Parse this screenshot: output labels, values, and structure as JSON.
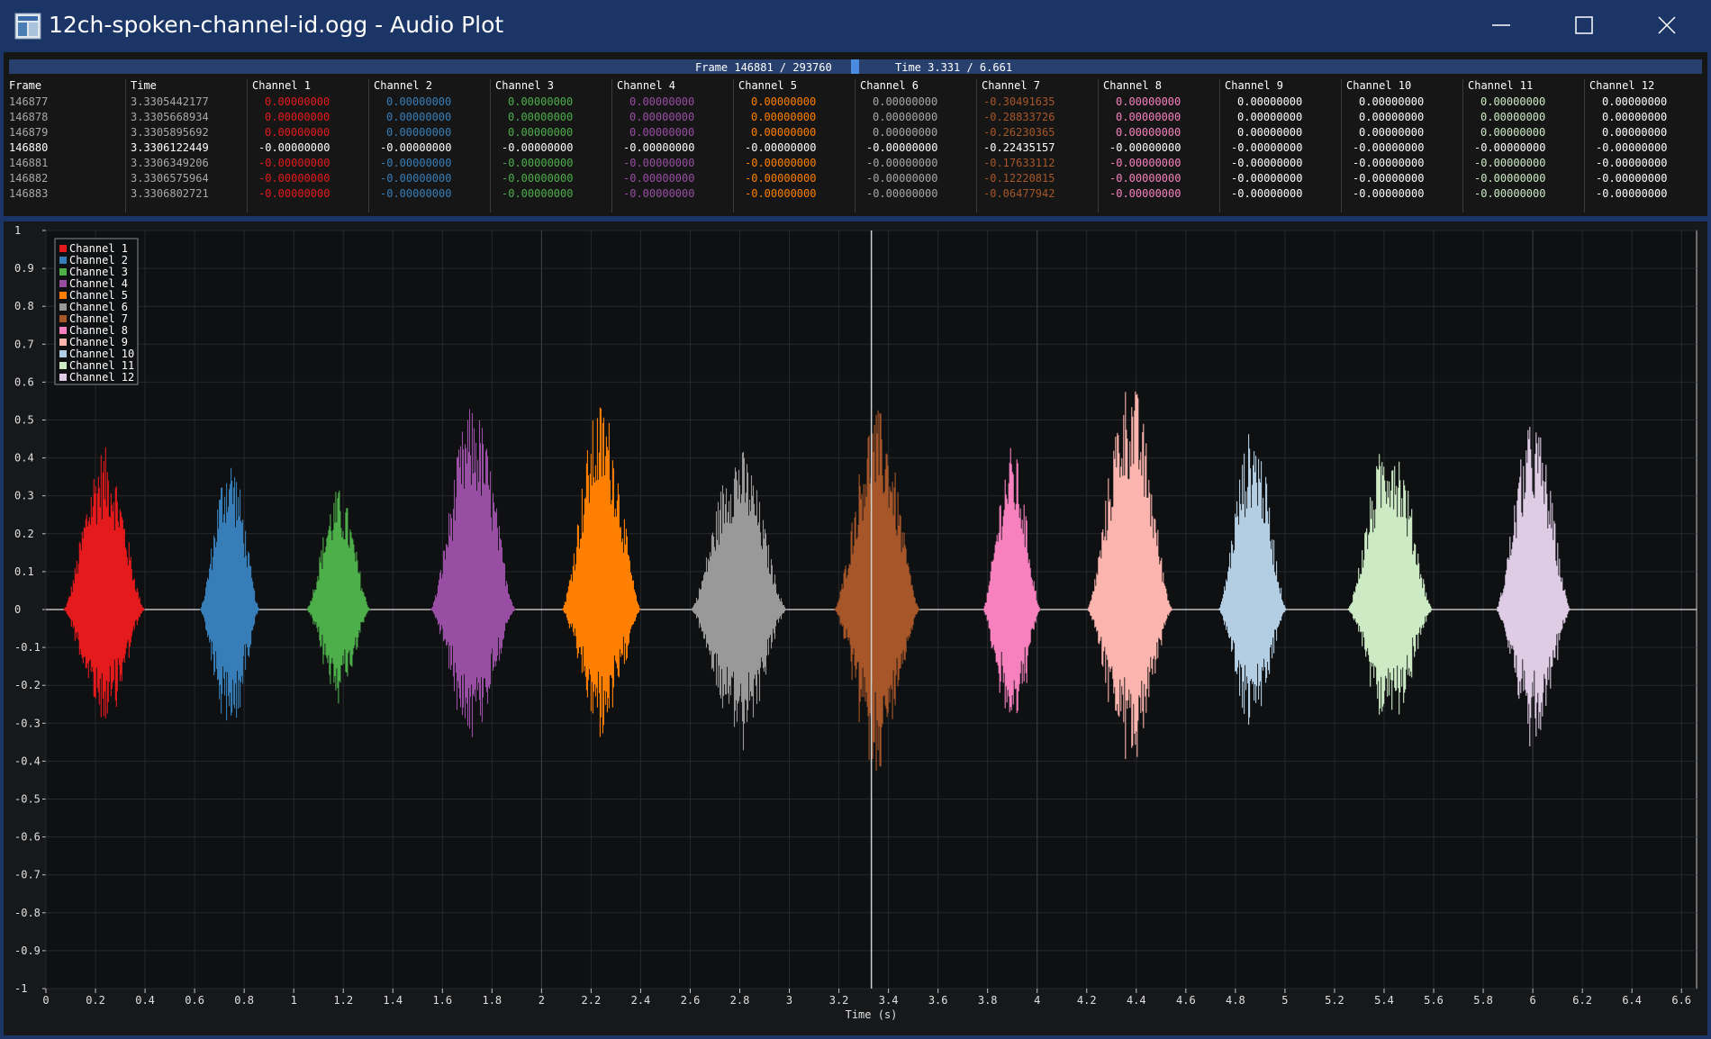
{
  "window": {
    "title": "12ch-spoken-channel-id.ogg - Audio Plot",
    "icon": "app-icon",
    "controls": [
      "minimize-icon",
      "maximize-icon",
      "close-icon"
    ]
  },
  "status": {
    "frame_text": "Frame 146881 / 293760",
    "time_text": "Time 3.331 / 6.661",
    "position_fraction": 0.5
  },
  "table": {
    "headers": [
      "Frame",
      "Time",
      "Channel 1",
      "Channel 2",
      "Channel 3",
      "Channel 4",
      "Channel 5",
      "Channel 6",
      "Channel 7",
      "Channel 8",
      "Channel 9",
      "Channel 10",
      "Channel 11",
      "Channel 12"
    ],
    "current_frame": "146880",
    "rows": [
      {
        "frame": "146877",
        "time": "3.3305442177",
        "values": [
          "0.00000000",
          "0.00000000",
          "0.00000000",
          "0.00000000",
          "0.00000000",
          "0.00000000",
          "-0.30491635",
          "0.00000000",
          "0.00000000",
          "0.00000000",
          "0.00000000",
          "0.00000000"
        ]
      },
      {
        "frame": "146878",
        "time": "3.3305668934",
        "values": [
          "0.00000000",
          "0.00000000",
          "0.00000000",
          "0.00000000",
          "0.00000000",
          "0.00000000",
          "-0.28833726",
          "0.00000000",
          "0.00000000",
          "0.00000000",
          "0.00000000",
          "0.00000000"
        ]
      },
      {
        "frame": "146879",
        "time": "3.3305895692",
        "values": [
          "0.00000000",
          "0.00000000",
          "0.00000000",
          "0.00000000",
          "0.00000000",
          "0.00000000",
          "-0.26230365",
          "0.00000000",
          "0.00000000",
          "0.00000000",
          "0.00000000",
          "0.00000000"
        ]
      },
      {
        "frame": "146880",
        "time": "3.3306122449",
        "values": [
          "-0.00000000",
          "-0.00000000",
          "-0.00000000",
          "-0.00000000",
          "-0.00000000",
          "-0.00000000",
          "-0.22435157",
          "-0.00000000",
          "-0.00000000",
          "-0.00000000",
          "-0.00000000",
          "-0.00000000"
        ]
      },
      {
        "frame": "146881",
        "time": "3.3306349206",
        "values": [
          "-0.00000000",
          "-0.00000000",
          "-0.00000000",
          "-0.00000000",
          "-0.00000000",
          "-0.00000000",
          "-0.17633112",
          "-0.00000000",
          "-0.00000000",
          "-0.00000000",
          "-0.00000000",
          "-0.00000000"
        ]
      },
      {
        "frame": "146882",
        "time": "3.3306575964",
        "values": [
          "-0.00000000",
          "-0.00000000",
          "-0.00000000",
          "-0.00000000",
          "-0.00000000",
          "-0.00000000",
          "-0.12220815",
          "-0.00000000",
          "-0.00000000",
          "-0.00000000",
          "-0.00000000",
          "-0.00000000"
        ]
      },
      {
        "frame": "146883",
        "time": "3.3306802721",
        "values": [
          "-0.00000000",
          "-0.00000000",
          "-0.00000000",
          "-0.00000000",
          "-0.00000000",
          "-0.00000000",
          "-0.06477942",
          "-0.00000000",
          "-0.00000000",
          "-0.00000000",
          "-0.00000000",
          "-0.00000000"
        ]
      }
    ]
  },
  "colors": {
    "channels": [
      "#e41a1c",
      "#377eb8",
      "#4daf4a",
      "#984ea3",
      "#ff7f00",
      "#999999",
      "#a65628",
      "#f781bf",
      "#fbb4ae",
      "#b3cde3",
      "#ccebc5",
      "#decbe4"
    ],
    "text_channels": [
      "#e41a1c",
      "#377eb8",
      "#4daf4a",
      "#984ea3",
      "#ff7f00",
      "#a8a8a8",
      "#a65628",
      "#f781bf",
      "#ffffff",
      "#ffffff",
      "#ccebc5",
      "#ffffff"
    ],
    "background": "#17181a",
    "cursor": "#d0d0d0"
  },
  "chart_data": {
    "type": "line",
    "title": "",
    "xlabel": "Time (s)",
    "ylabel": "",
    "xlim": [
      0,
      6.661
    ],
    "ylim": [
      -1,
      1
    ],
    "xticks": [
      "0",
      "0.2",
      "0.4",
      "0.6",
      "0.8",
      "1",
      "1.2",
      "1.4",
      "1.6",
      "1.8",
      "2",
      "2.2",
      "2.4",
      "2.6",
      "2.8",
      "3",
      "3.2",
      "3.4",
      "3.6",
      "3.8",
      "4",
      "4.2",
      "4.4",
      "4.6",
      "4.8",
      "5",
      "5.2",
      "5.4",
      "5.6",
      "5.8",
      "6",
      "6.2",
      "6.4",
      "6.6"
    ],
    "yticks": [
      "1",
      "0.9",
      "0.8",
      "0.7",
      "0.6",
      "0.5",
      "0.4",
      "0.3",
      "0.2",
      "0.1",
      "0",
      "-0.1",
      "-0.2",
      "-0.3",
      "-0.4",
      "-0.5",
      "-0.6",
      "-0.7",
      "-0.8",
      "-0.9",
      "-1"
    ],
    "cursor_time": 3.331,
    "grid": true,
    "legend_position": "top-left",
    "series": [
      {
        "name": "Channel 1",
        "start": 0.07,
        "end": 0.45,
        "max": 0.43,
        "min": -0.34
      },
      {
        "name": "Channel 2",
        "start": 0.62,
        "end": 0.9,
        "max": 0.41,
        "min": -0.37
      },
      {
        "name": "Channel 3",
        "start": 1.05,
        "end": 1.35,
        "max": 0.32,
        "min": -0.26
      },
      {
        "name": "Channel 4",
        "start": 1.55,
        "end": 1.95,
        "max": 0.54,
        "min": -0.36
      },
      {
        "name": "Channel 5",
        "start": 2.08,
        "end": 2.45,
        "max": 0.55,
        "min": -0.37
      },
      {
        "name": "Channel 6",
        "start": 2.6,
        "end": 3.05,
        "max": 0.43,
        "min": -0.39
      },
      {
        "name": "Channel 7",
        "start": 3.18,
        "end": 3.58,
        "max": 0.53,
        "min": -0.46
      },
      {
        "name": "Channel 8",
        "start": 3.78,
        "end": 4.05,
        "max": 0.43,
        "min": -0.37
      },
      {
        "name": "Channel 9",
        "start": 4.2,
        "end": 4.6,
        "max": 0.61,
        "min": -0.44
      },
      {
        "name": "Channel 10",
        "start": 4.73,
        "end": 5.05,
        "max": 0.48,
        "min": -0.34
      },
      {
        "name": "Channel 11",
        "start": 5.25,
        "end": 5.65,
        "max": 0.47,
        "min": -0.34
      },
      {
        "name": "Channel 12",
        "start": 5.85,
        "end": 6.2,
        "max": 0.5,
        "min": -0.38
      }
    ]
  }
}
